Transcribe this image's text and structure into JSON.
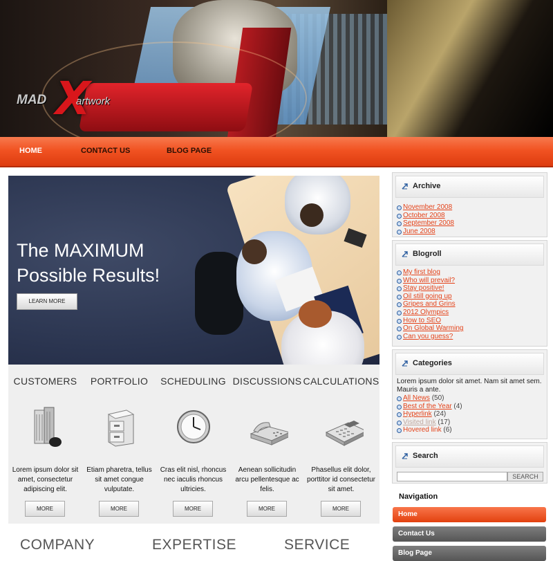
{
  "logo": {
    "mad": "MAD",
    "x": "X",
    "artwork": "artwork"
  },
  "topnav": {
    "items": [
      "HOME",
      "CONTACT US",
      "BLOG PAGE"
    ],
    "active_index": 0
  },
  "hero": {
    "title_line1": "The MAXIMUM",
    "title_line2": "Possible Results!",
    "button": "LEARN MORE"
  },
  "features": [
    {
      "title": "CUSTOMERS",
      "icon": "building-icon",
      "desc": "Lorem ipsum dolor sit amet, consectetur adipiscing elit.",
      "button": "MORE"
    },
    {
      "title": "PORTFOLIO",
      "icon": "file-cabinet-icon",
      "desc": "Etiam pharetra, tellus sit amet congue vulputate.",
      "button": "MORE"
    },
    {
      "title": "SCHEDULING",
      "icon": "clock-icon",
      "desc": "Cras elit nisl, rhoncus nec iaculis rhoncus ultricies.",
      "button": "MORE"
    },
    {
      "title": "DISCUSSIONS",
      "icon": "telephone-icon",
      "desc": "Aenean sollicitudin arcu  pellentesque ac felis.",
      "button": "MORE"
    },
    {
      "title": "CALCULATIONS",
      "icon": "calculator-icon",
      "desc": "Phasellus elit dolor, porttitor id consectetur sit amet.",
      "button": "MORE"
    }
  ],
  "bottom_headings": [
    "COMPANY",
    "EXPERTISE",
    "SERVICE"
  ],
  "sidebar": {
    "archive": {
      "title": "Archive",
      "items": [
        "November 2008",
        "October 2008",
        "September 2008",
        "June 2008"
      ]
    },
    "blogroll": {
      "title": "Blogroll",
      "items": [
        "My first blog",
        "Who will prevail?",
        "Stay positive!",
        "Oil still going up",
        "Gripes and Grins",
        "2012 Olympics",
        "How to SEO",
        "On Global Warming",
        "Can you guess?"
      ]
    },
    "categories": {
      "title": "Categories",
      "text": "Lorem ipsum dolor sit amet. Nam sit amet sem. Mauris a ante.",
      "items": [
        {
          "label": "All News",
          "count": "(50)",
          "visited": false
        },
        {
          "label": "Best of the Year",
          "count": "(4)",
          "visited": false
        },
        {
          "label": "Hyperlink",
          "count": "(24)",
          "visited": false
        },
        {
          "label": "Visited link",
          "count": "(17)",
          "visited": true
        },
        {
          "label": "Hovered link",
          "count": "(6)",
          "visited": false
        }
      ]
    },
    "search": {
      "title": "Search",
      "button": "SEARCH",
      "value": ""
    },
    "navigation": {
      "title": "Navigation",
      "items": [
        "Home",
        "Contact Us",
        "Blog Page"
      ],
      "active_index": 0
    }
  },
  "colors": {
    "accent": "#f15322",
    "link": "#e4431a",
    "feature_bg": "#efefef",
    "sidebar_bg": "#f1f1f1"
  }
}
